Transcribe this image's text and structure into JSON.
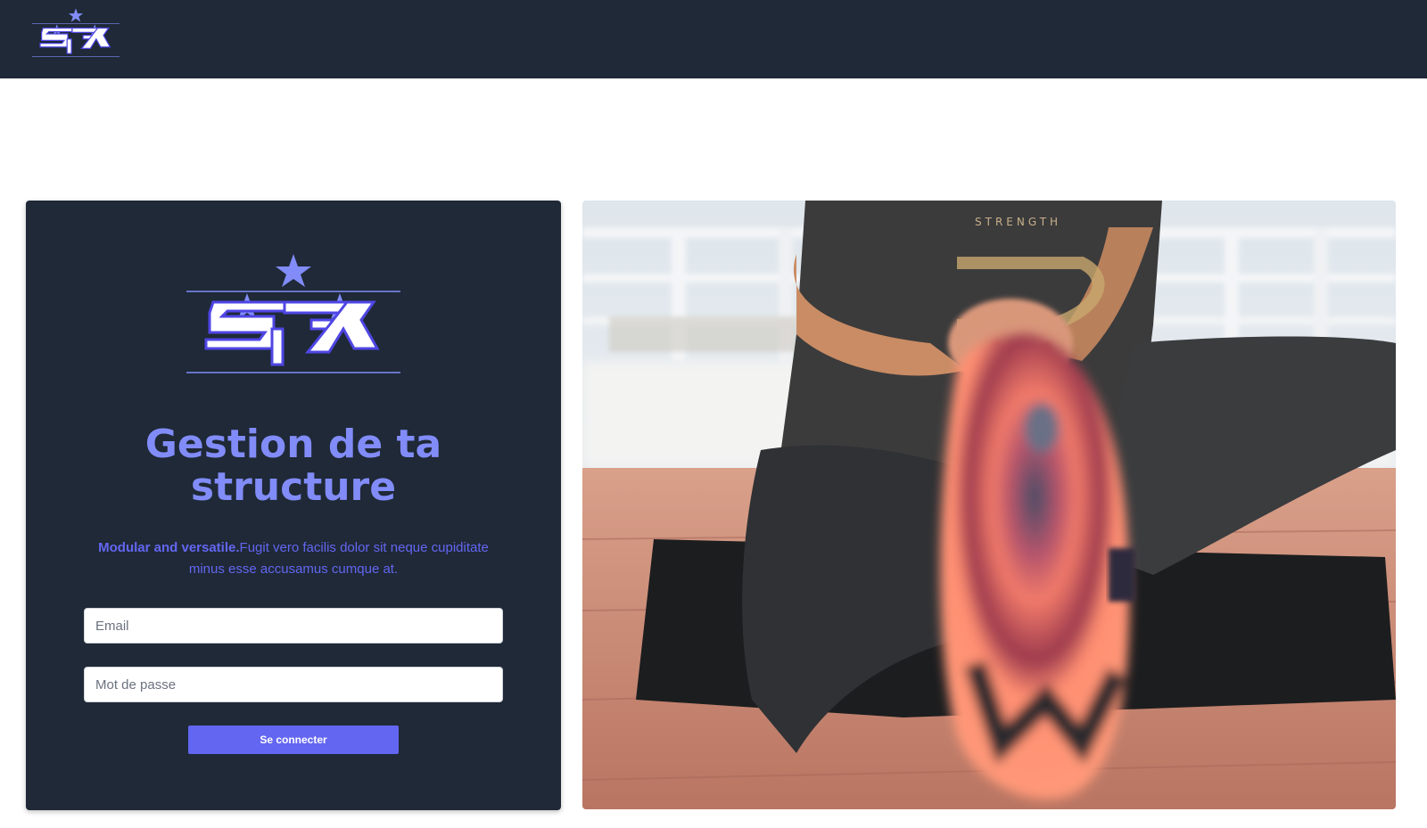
{
  "header": {
    "logo_icon": "spx-logo"
  },
  "login": {
    "logo_icon": "spx-logo",
    "title_line1": "Gestion de ta",
    "title_line2": "structure",
    "description_bold": "Modular and versatile.",
    "description_text": "Fugit vero facilis dolor sit neque cupiditate minus esse accusamus cumque at.",
    "email_placeholder": "Email",
    "email_value": "",
    "password_placeholder": "Mot de passe",
    "password_value": "",
    "submit_label": "Se connecter"
  },
  "hero_image": {
    "subject": "woman-stretching-on-yoga-mat-photo",
    "shirt_text": "STRENGTH"
  },
  "colors": {
    "header_bg": "#1f2937",
    "card_bg": "#1f2937",
    "accent": "#6366f1",
    "title": "#818cf8"
  }
}
